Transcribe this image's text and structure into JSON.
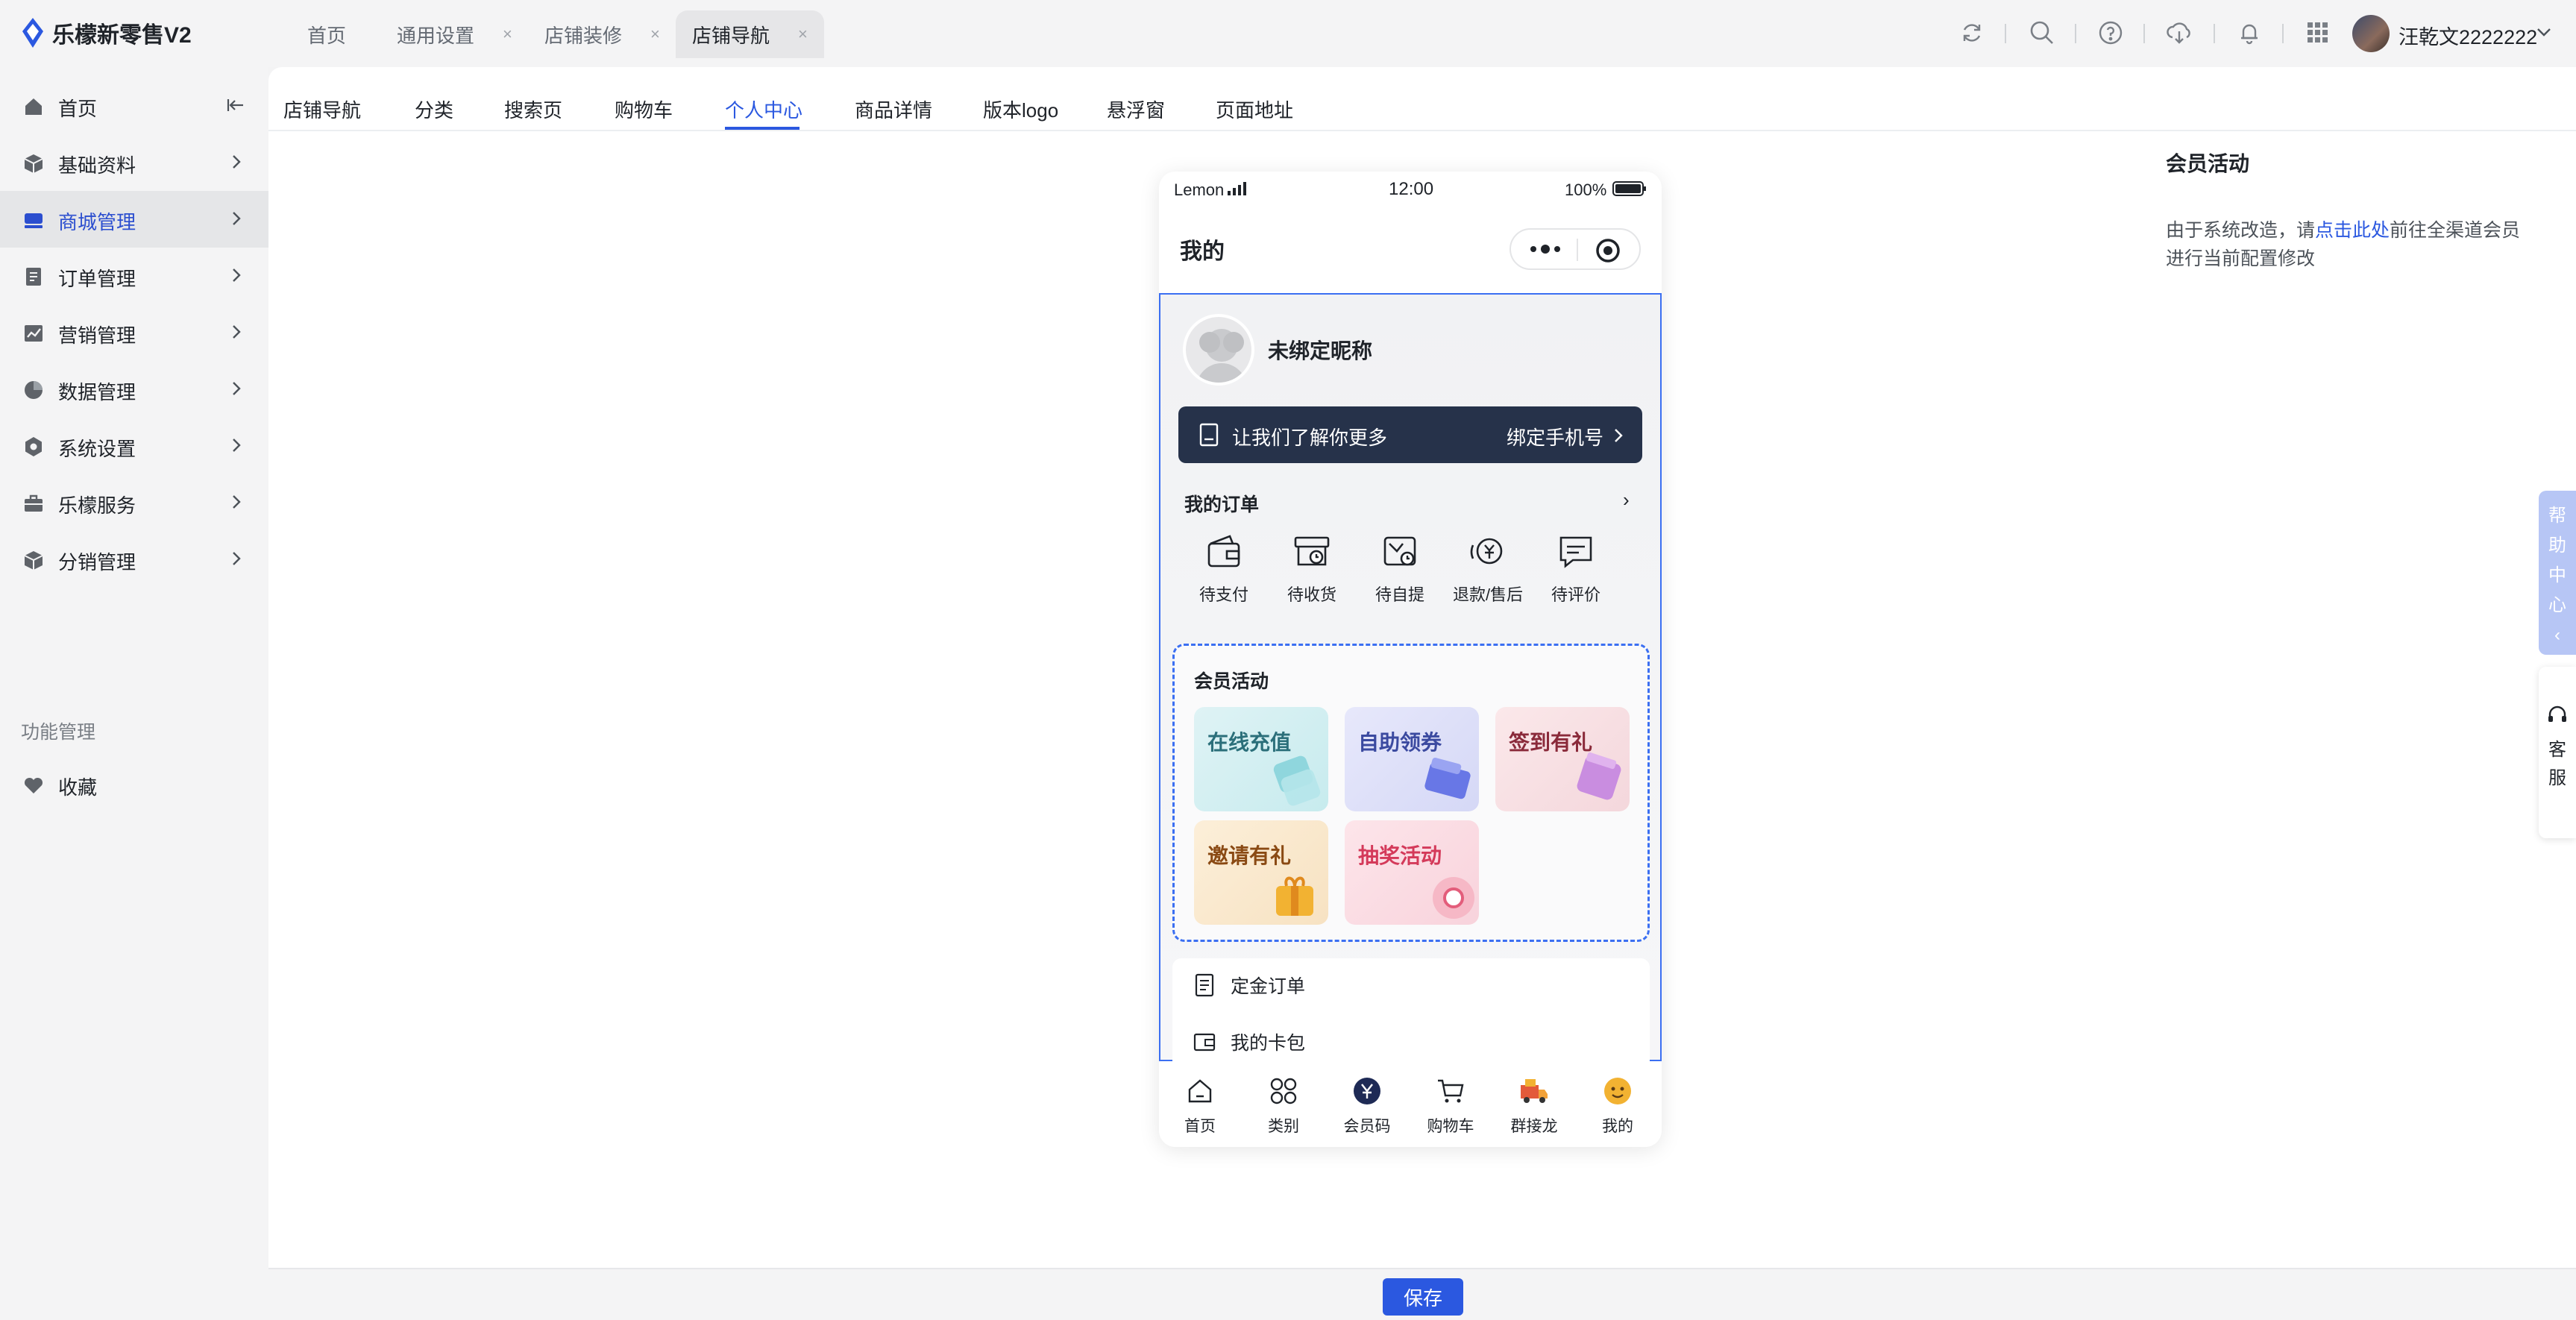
{
  "app": {
    "title": "乐檬新零售V2"
  },
  "top_tabs": [
    {
      "label": "首页",
      "closable": false
    },
    {
      "label": "通用设置",
      "closable": true
    },
    {
      "label": "店铺装修",
      "closable": true
    },
    {
      "label": "店铺导航",
      "closable": true,
      "active": true
    }
  ],
  "top_close_glyph": "×",
  "toolbar_icons": [
    "refresh-icon",
    "search-icon",
    "help-circle-icon",
    "cloud-download-icon",
    "bell-icon",
    "apps-grid-icon"
  ],
  "user": {
    "name": "汪乾文2222222"
  },
  "sidebar": {
    "items": [
      {
        "label": "首页",
        "icon": "home-icon"
      },
      {
        "label": "基础资料",
        "icon": "box-icon"
      },
      {
        "label": "商城管理",
        "icon": "store-icon",
        "active": true
      },
      {
        "label": "订单管理",
        "icon": "order-icon"
      },
      {
        "label": "营销管理",
        "icon": "chart-line-icon"
      },
      {
        "label": "数据管理",
        "icon": "pie-icon"
      },
      {
        "label": "系统设置",
        "icon": "settings-icon"
      },
      {
        "label": "乐檬服务",
        "icon": "briefcase-icon"
      },
      {
        "label": "分销管理",
        "icon": "share-icon"
      }
    ],
    "section_label": "功能管理",
    "favorites": {
      "label": "收藏",
      "icon": "heart-icon"
    }
  },
  "subtabs": [
    "店铺导航",
    "分类",
    "搜索页",
    "购物车",
    "个人中心",
    "商品详情",
    "版本logo",
    "悬浮窗",
    "页面地址"
  ],
  "subtabs_active_index": 4,
  "phone": {
    "carrier": "Lemon",
    "time": "12:00",
    "battery": "100%",
    "page_title": "我的",
    "nickname": "未绑定昵称",
    "bind_banner": {
      "text": "让我们了解你更多",
      "action": "绑定手机号"
    },
    "orders": {
      "title": "我的订单",
      "arrow": "›",
      "items": [
        "待支付",
        "待收货",
        "待自提",
        "退款/售后",
        "待评价"
      ]
    },
    "member": {
      "title": "会员活动",
      "tiles": [
        {
          "label": "在线充值",
          "color": "#2b6f7a"
        },
        {
          "label": "自助领券",
          "color": "#3b4aa0"
        },
        {
          "label": "签到有礼",
          "color": "#8a2a3a"
        },
        {
          "label": "邀请有礼",
          "color": "#8a4a14"
        },
        {
          "label": "抽奖活动",
          "color": "#d43a5a"
        }
      ]
    },
    "list": [
      "定金订单",
      "我的卡包"
    ],
    "tabbar": [
      "首页",
      "类别",
      "会员码",
      "购物车",
      "群接龙",
      "我的"
    ]
  },
  "right_panel": {
    "title": "会员活动",
    "text_before": "由于系统改造，请",
    "link": "点击此处",
    "text_after": "前往全渠道会员进行当前配置修改"
  },
  "help_float": {
    "chars": [
      "帮",
      "助",
      "中",
      "心",
      "‹"
    ]
  },
  "service_float": {
    "chars": [
      "客",
      "服"
    ]
  },
  "save_label": "保存",
  "accent_color": "#2b58e0"
}
